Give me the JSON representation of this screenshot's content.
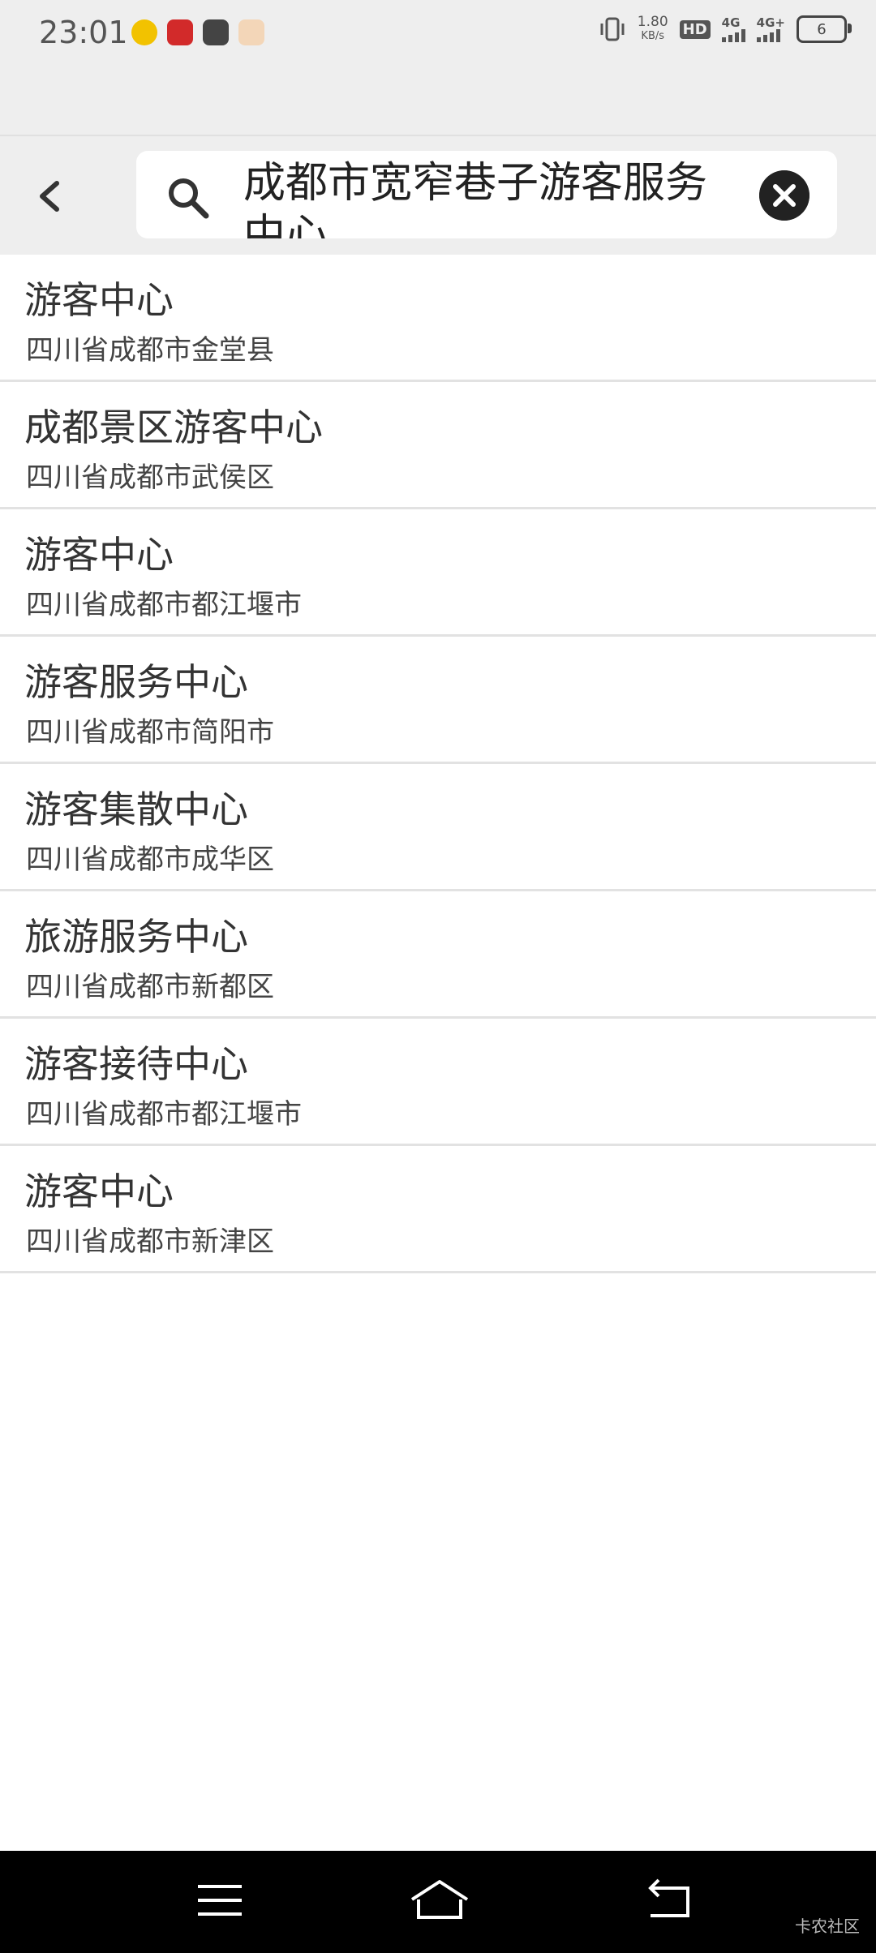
{
  "status_bar": {
    "time": "23:01",
    "net_speed": "1.80",
    "net_unit": "KB/s",
    "hd_label": "HD",
    "sig1": "4G",
    "sig2": "4G+",
    "battery": "6",
    "app_icons": [
      "coin-app-icon",
      "red-app-icon",
      "bag-app-icon",
      "cat-app-icon"
    ]
  },
  "search": {
    "query": "成都市宽窄巷子游客服务中心"
  },
  "results": [
    {
      "title": "游客中心",
      "subtitle": "四川省成都市金堂县"
    },
    {
      "title": "成都景区游客中心",
      "subtitle": "四川省成都市武侯区"
    },
    {
      "title": "游客中心",
      "subtitle": "四川省成都市都江堰市"
    },
    {
      "title": "游客服务中心",
      "subtitle": "四川省成都市简阳市"
    },
    {
      "title": "游客集散中心",
      "subtitle": "四川省成都市成华区"
    },
    {
      "title": "旅游服务中心",
      "subtitle": "四川省成都市新都区"
    },
    {
      "title": "游客接待中心",
      "subtitle": "四川省成都市都江堰市"
    },
    {
      "title": "游客中心",
      "subtitle": "四川省成都市新津区"
    }
  ],
  "watermark": "卡农社区",
  "colors": {
    "bar_bg": "#eeeeee",
    "nav_bg": "#000000",
    "divider": "#e2e2e2"
  }
}
